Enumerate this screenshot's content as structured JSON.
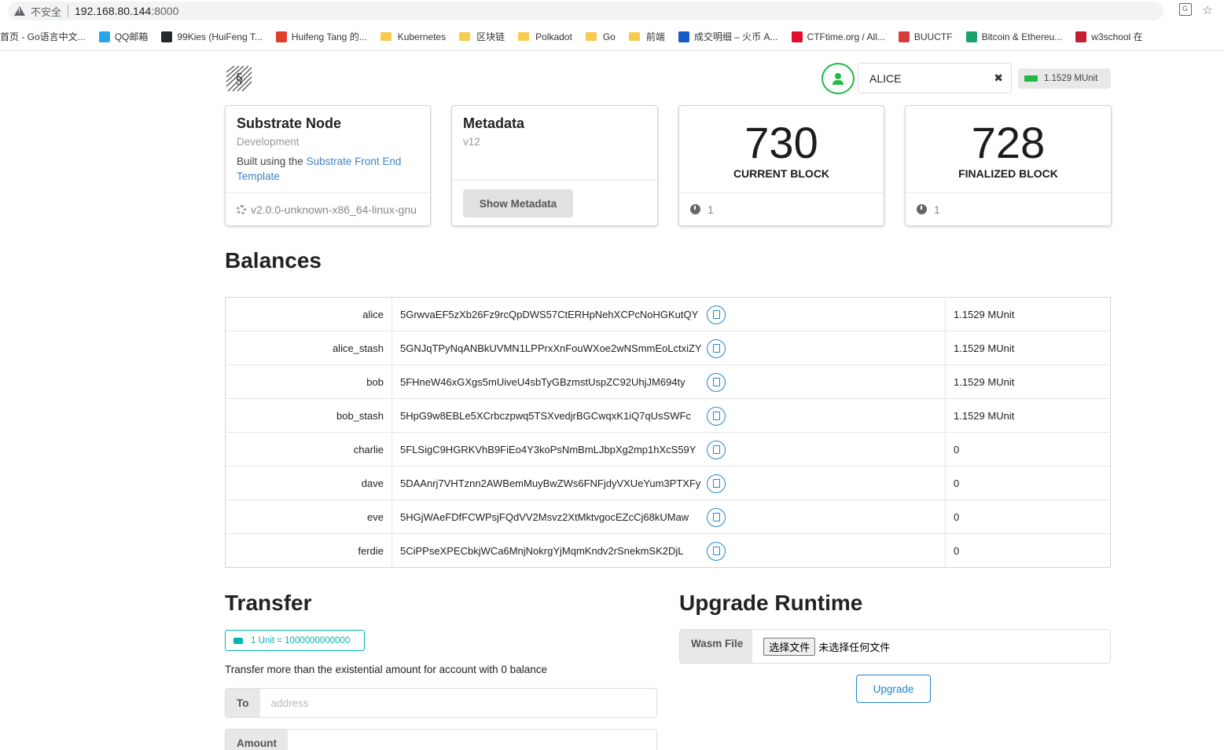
{
  "browser": {
    "insecure_label": "不安全",
    "url_host": "192.168.80.144",
    "url_port": ":8000",
    "bookmarks": [
      {
        "label": "首页 - Go语言中文...",
        "type": "site",
        "color": "#ffffff"
      },
      {
        "label": "QQ邮箱",
        "type": "site",
        "color": "#2aa4e8"
      },
      {
        "label": "99Kies (HuiFeng T...",
        "type": "site",
        "color": "#24292e"
      },
      {
        "label": "Huifeng Tang 的...",
        "type": "site",
        "color": "#e0402a"
      },
      {
        "label": "Kubernetes",
        "type": "folder"
      },
      {
        "label": "区块链",
        "type": "folder"
      },
      {
        "label": "Polkadot",
        "type": "folder"
      },
      {
        "label": "Go",
        "type": "folder"
      },
      {
        "label": "前端",
        "type": "folder"
      },
      {
        "label": "成交明细 – 火币 A...",
        "type": "site",
        "color": "#1a5bcc"
      },
      {
        "label": "CTFtime.org / All...",
        "type": "site",
        "color": "#e0102a"
      },
      {
        "label": "BUUCTF",
        "type": "site",
        "color": "#d63c3c"
      },
      {
        "label": "Bitcoin & Ethereu...",
        "type": "site",
        "color": "#1aa36f"
      },
      {
        "label": "w3school 在",
        "type": "site",
        "color": "#c02030"
      }
    ]
  },
  "account": {
    "selected": "ALICE",
    "balance": "1.1529 MUnit"
  },
  "node_card": {
    "title": "Substrate Node",
    "meta": "Development",
    "desc_prefix": "Built using the ",
    "desc_link": "Substrate Front End Template",
    "version": "v2.0.0-unknown-x86_64-linux-gnu"
  },
  "metadata_card": {
    "title": "Metadata",
    "version": "v12",
    "button": "Show Metadata"
  },
  "current_block": {
    "value": "730",
    "label": "Current Block",
    "extra": "1"
  },
  "finalized_block": {
    "value": "728",
    "label": "Finalized Block",
    "extra": "1"
  },
  "balances": {
    "title": "Balances",
    "rows": [
      {
        "name": "alice",
        "address": "5GrwvaEF5zXb26Fz9rcQpDWS57CtERHpNehXCPcNoHGKutQY",
        "balance": "1.1529 MUnit"
      },
      {
        "name": "alice_stash",
        "address": "5GNJqTPyNqANBkUVMN1LPPrxXnFouWXoe2wNSmmEoLctxiZY",
        "balance": "1.1529 MUnit"
      },
      {
        "name": "bob",
        "address": "5FHneW46xGXgs5mUiveU4sbTyGBzmstUspZC92UhjJM694ty",
        "balance": "1.1529 MUnit"
      },
      {
        "name": "bob_stash",
        "address": "5HpG9w8EBLe5XCrbczpwq5TSXvedjrBGCwqxK1iQ7qUsSWFc",
        "balance": "1.1529 MUnit"
      },
      {
        "name": "charlie",
        "address": "5FLSigC9HGRKVhB9FiEo4Y3koPsNmBmLJbpXg2mp1hXcS59Y",
        "balance": "0"
      },
      {
        "name": "dave",
        "address": "5DAAnrj7VHTznn2AWBemMuyBwZWs6FNFjdyVXUeYum3PTXFy",
        "balance": "0"
      },
      {
        "name": "eve",
        "address": "5HGjWAeFDfFCWPsjFQdVV2Msvz2XtMktvgocEZcCj68kUMaw",
        "balance": "0"
      },
      {
        "name": "ferdie",
        "address": "5CiPPseXPECbkjWCa6MnjNokrgYjMqmKndv2rSnekmSK2DjL",
        "balance": "0"
      }
    ]
  },
  "transfer": {
    "title": "Transfer",
    "unit_badge": "1 Unit = 1000000000000",
    "note": "Transfer more than the existential amount for account with 0 balance",
    "to_label": "To",
    "to_placeholder": "address",
    "amount_label": "Amount"
  },
  "upgrade": {
    "title": "Upgrade Runtime",
    "wasm_label": "Wasm File",
    "file_button": "选择文件",
    "file_status": "未选择任何文件",
    "button": "Upgrade"
  }
}
